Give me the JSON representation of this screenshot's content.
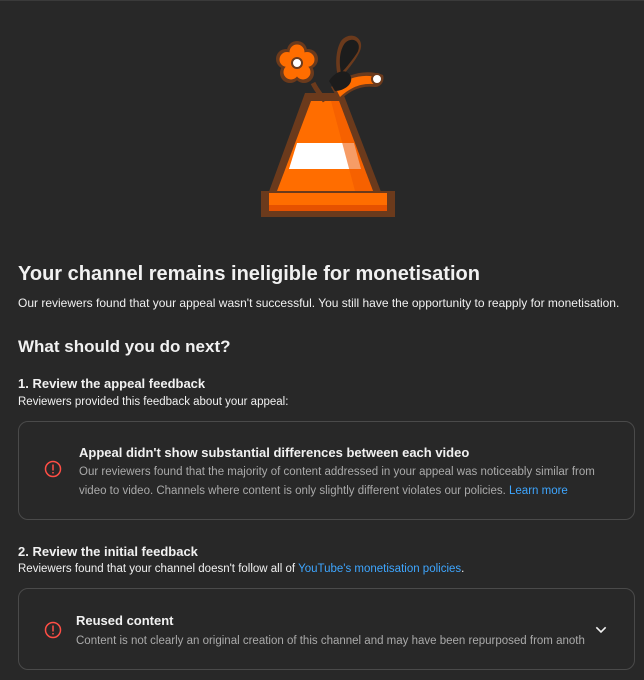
{
  "illustration": {
    "icon": "traffic-cone-with-flower-illustration"
  },
  "header": {
    "title": "Your channel remains ineligible for monetisation",
    "subtitle": "Our reviewers found that your appeal wasn't successful. You still have the opportunity to reapply for monetisation."
  },
  "next": {
    "heading": "What should you do next?"
  },
  "step1": {
    "heading": "1. Review the appeal feedback",
    "description": "Reviewers provided this feedback about your appeal:",
    "card": {
      "icon": "alert-circle-icon",
      "title": "Appeal didn't show substantial differences between each video",
      "body_line1": "Our reviewers found that the majority of content addressed in your appeal was noticeably similar from",
      "body_line2": "video to video. Channels where content is only slightly different violates our policies.",
      "link": "Learn more"
    }
  },
  "step2": {
    "heading": "2. Review the initial feedback",
    "description_prefix": "Reviewers found that your channel doesn't follow all of ",
    "description_link": "YouTube's monetisation policies",
    "description_suffix": ".",
    "card": {
      "icon": "alert-circle-icon",
      "title": "Reused content",
      "body": "Content is not clearly an original creation of this channel and may have been repurposed from anoth"
    }
  },
  "colors": {
    "background": "#282828",
    "text": "#f1f1f1",
    "muted": "#aaaaaa",
    "link": "#3ea6ff",
    "alert": "#ff4e45",
    "cone_orange": "#ff6d00",
    "cone_outline": "#6b3a1c"
  }
}
